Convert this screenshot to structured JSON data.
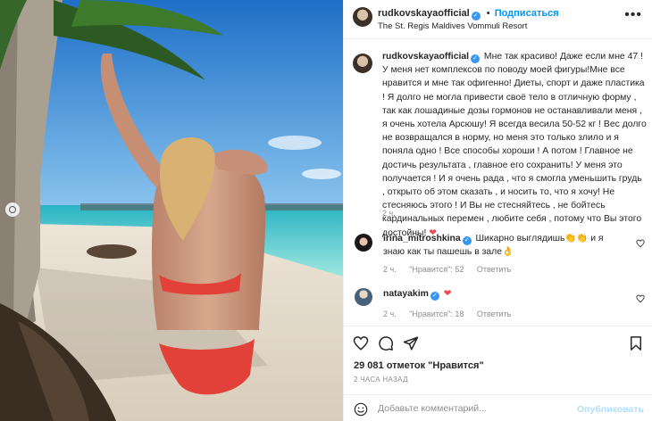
{
  "post": {
    "username": "rudkovskayaofficial",
    "follow_label": "Подписаться",
    "separator": "•",
    "location": "The St. Regis Maldives Vommuli Resort",
    "more_icon": "more-horizontal-icon"
  },
  "caption": {
    "username": "rudkovskayaofficial",
    "text": "Мне так красиво! Даже если мне 47 ! У меня нет комплексов по поводу моей фигуры!Мне все нравится и мне так офигенно! Диеты, спорт и даже пластика ! Я долго не могла привести своё тело в отличную форму , так как лошадиные дозы гормонов не останавливали меня , я очень хотела Арсюшу! Я всегда весила 50-52 кг ! Вес долго не возвращался в норму, но меня это только злило и я поняла одно ! Все способы хороши ! А потом ! Главное не достичь результата , главное его сохранить! У меня это получается ! И я очень рада , что я смогла уменьшить грудь , открыто об этом сказать , и носить то, что я хочу! Не стесняюсь этого ! И Вы не стесняйтесь , не бойтесь кардинальных перемен , любите себя , потому что Вы этого достойны!",
    "emoji": "❤",
    "time": "2 ч."
  },
  "comments": [
    {
      "username": "irina_mitroshkina",
      "text": "Шикарно выглядишь👏👏 и я знаю как ты пашешь в зале👌",
      "time": "2 ч.",
      "likes": "\"Нравится\": 52",
      "reply": "Ответить"
    },
    {
      "username": "natayakim",
      "text": "❤",
      "time": "2 ч.",
      "likes": "\"Нравится\": 18",
      "reply": "Ответить"
    }
  ],
  "likes_count": "29 081 отметок \"Нравится\"",
  "time_ago": "2 ЧАСА НАЗАД",
  "add_comment": {
    "placeholder": "Добавьте комментарий...",
    "publish_label": "Опубликовать"
  },
  "colors": {
    "accent": "#0095f6",
    "heart": "#ed4956",
    "verified": "#3897f0",
    "muted": "#8e8e8e"
  }
}
